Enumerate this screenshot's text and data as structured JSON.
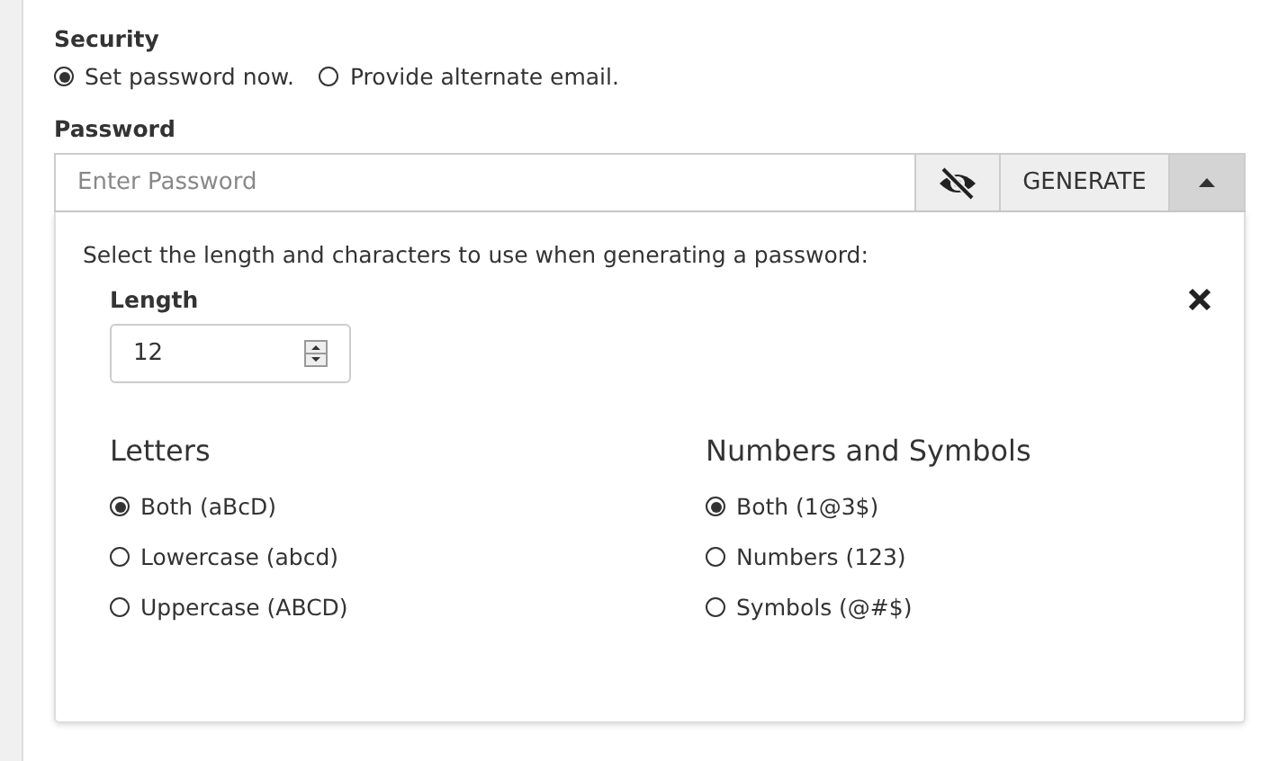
{
  "security": {
    "label": "Security",
    "options": [
      {
        "label": "Set password now.",
        "selected": true
      },
      {
        "label": "Provide alternate email.",
        "selected": false
      }
    ]
  },
  "password": {
    "label": "Password",
    "placeholder": "Enter Password",
    "generate": "GENERATE",
    "panel_open": true
  },
  "generator": {
    "instructions": "Select the length and characters to use when generating a password:",
    "length_label": "Length",
    "length_value": "12",
    "groups": [
      {
        "title": "Letters",
        "options": [
          {
            "label": "Both (aBcD)",
            "selected": true
          },
          {
            "label": "Lowercase (abcd)",
            "selected": false
          },
          {
            "label": "Uppercase (ABCD)",
            "selected": false
          }
        ]
      },
      {
        "title": "Numbers and Symbols",
        "options": [
          {
            "label": "Both (1@3$)",
            "selected": true
          },
          {
            "label": "Numbers (123)",
            "selected": false
          },
          {
            "label": "Symbols (@#$)",
            "selected": false
          }
        ]
      }
    ]
  }
}
